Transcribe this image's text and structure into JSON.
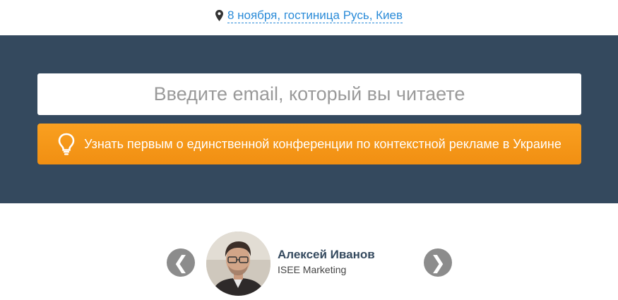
{
  "event": {
    "location": "8 ноября, гостиница Русь, Киев"
  },
  "subscribe": {
    "email_placeholder": "Введите email, который вы читаете",
    "button_label": "Узнать первым о единственной конференции по контекстной рекламе в Украине"
  },
  "speakers": {
    "prev_arrow": "❮",
    "next_arrow": "❯",
    "current": {
      "name": "Алексей Иванов",
      "company": "ISEE Marketing"
    }
  },
  "colors": {
    "hero_bg": "#34495e",
    "button_orange": "#f39a16",
    "link_blue": "#2a8bd8",
    "arrow_gray": "#8c8c8c"
  },
  "icons": {
    "location": "map-pin-icon",
    "button": "lightbulb-icon"
  }
}
